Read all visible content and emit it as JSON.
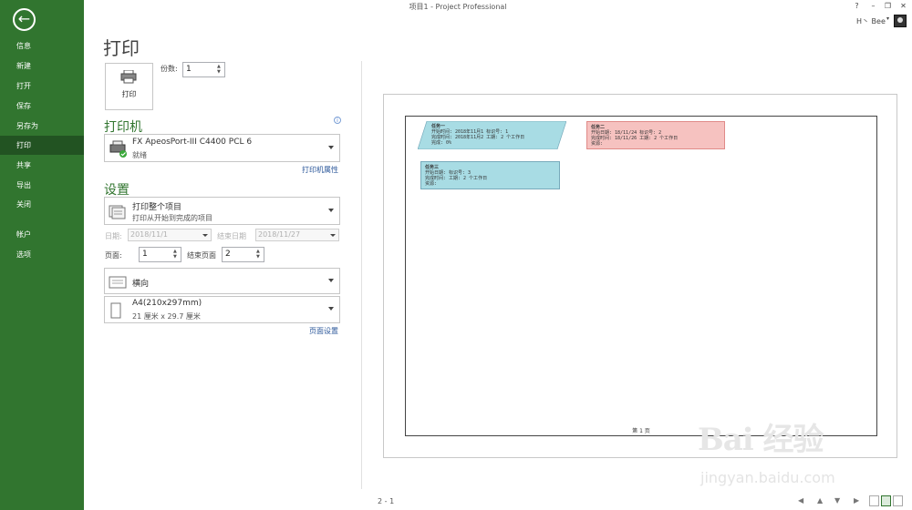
{
  "window": {
    "title": "项目1 - Project Professional",
    "user": "H丶 Bee"
  },
  "titlebar_buttons": [
    "?",
    "–",
    "❐",
    "✕"
  ],
  "sidebar": {
    "back_icon": "back-arrow-icon",
    "items": [
      {
        "label": "信息"
      },
      {
        "label": "新建"
      },
      {
        "label": "打开"
      },
      {
        "label": "保存"
      },
      {
        "label": "另存为"
      },
      {
        "label": "打印"
      },
      {
        "label": "共享"
      },
      {
        "label": "导出"
      },
      {
        "label": "关闭"
      },
      {
        "label": "帐户"
      },
      {
        "label": "选项"
      }
    ],
    "active": "打印"
  },
  "page_title": "打印",
  "print_button": {
    "label": "打印",
    "icon": "printer-icon"
  },
  "copies": {
    "label": "份数:",
    "value": "1"
  },
  "printer": {
    "section_title": "打印机",
    "name": "FX ApeosPort-III C4400 PCL 6",
    "status": "就绪",
    "properties_link": "打印机属性"
  },
  "settings": {
    "section_title": "设置",
    "range_main": "打印整个项目",
    "range_sub": "打印从开始到完成的项目",
    "date_label": "日期:",
    "date_start": "2018/11/1",
    "date_end_label": "结束日期",
    "date_end": "2018/11/27",
    "page_label": "页面:",
    "page_start": "1",
    "end_page_label": "结束页面",
    "end_page": "2",
    "orientation": "横向",
    "paper_main": "A4(210x297mm)",
    "paper_sub": "21 厘米 x 29.7 厘米",
    "page_setup_link": "页面设置"
  },
  "preview": {
    "tasks": [
      {
        "title": "任务一",
        "lines": [
          "开始时间: 2018年11月1 标识号:  1",
          "完成时间: 2018年11月2 工期:   2 个工作日",
          "完成: 0%"
        ],
        "color": "#a8dce4"
      },
      {
        "title": "任务二",
        "lines": [
          "开始日期: 18/11/24   标识号:  2",
          "完成时间: 18/11/26   工期:   2 个工作日",
          "资源:"
        ],
        "color": "#f6c2c0"
      },
      {
        "title": "任务三",
        "lines": [
          "开始日期:          标识号:  3",
          "完成时间:          工期:   2 个工作日",
          "资源:"
        ],
        "color": "#a8dce4"
      }
    ],
    "page_footer": "第 1 页",
    "page_count": "2 - 1"
  },
  "watermark": {
    "main": "Bai 经验",
    "sub": "jingyan.baidu.com"
  }
}
